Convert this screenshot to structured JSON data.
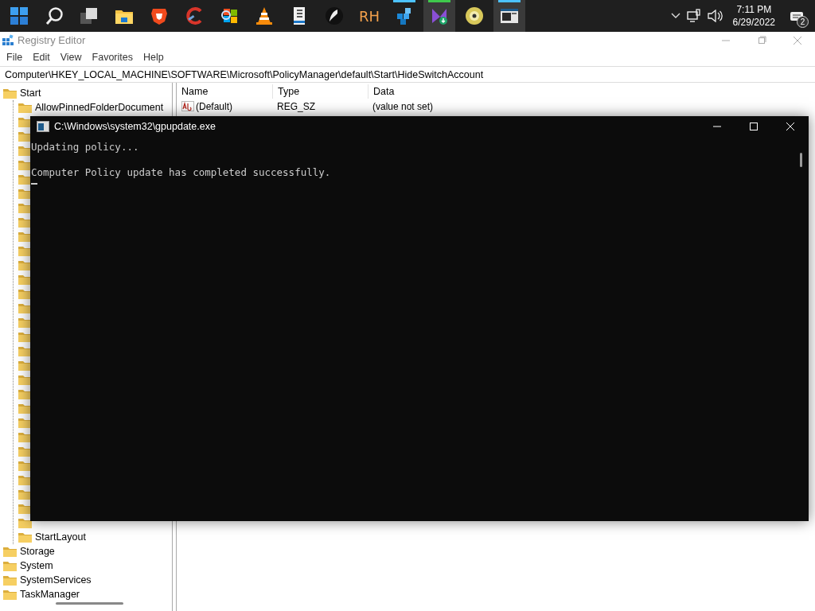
{
  "taskbar": {
    "apps": [
      {
        "kind": "start",
        "indicator": false,
        "selected": false
      },
      {
        "kind": "search",
        "indicator": false,
        "selected": false
      },
      {
        "kind": "taskview",
        "indicator": false,
        "selected": false
      },
      {
        "kind": "explorer",
        "indicator": false,
        "selected": false
      },
      {
        "kind": "lion",
        "indicator": false,
        "selected": false
      },
      {
        "kind": "cleaner",
        "indicator": false,
        "selected": false
      },
      {
        "kind": "flag",
        "indicator": false,
        "selected": false
      },
      {
        "kind": "cone",
        "indicator": false,
        "selected": false
      },
      {
        "kind": "book",
        "indicator": false,
        "selected": false
      },
      {
        "kind": "feather",
        "indicator": false,
        "selected": false
      },
      {
        "kind": "text",
        "label": "RH",
        "indicator": false,
        "selected": false
      },
      {
        "kind": "cubes",
        "indicator": true,
        "selected": false
      },
      {
        "kind": "installer",
        "indicator": true,
        "selected": true
      },
      {
        "kind": "disc",
        "indicator": false,
        "selected": false
      },
      {
        "kind": "console",
        "indicator": true,
        "selected": true
      }
    ],
    "tray": {
      "time": "7:11 PM",
      "date": "6/29/2022",
      "notifications": "2"
    }
  },
  "regedit": {
    "title": "Registry Editor",
    "menu": [
      "File",
      "Edit",
      "View",
      "Favorites",
      "Help"
    ],
    "address": "Computer\\HKEY_LOCAL_MACHINE\\SOFTWARE\\Microsoft\\PolicyManager\\default\\Start\\HideSwitchAccount",
    "tree": [
      {
        "label": "Start",
        "children": [
          {
            "kind": "folder",
            "label": "AllowPinnedFolderDocument"
          },
          {
            "kind": "folder"
          },
          {
            "kind": "folder"
          },
          {
            "kind": "folder"
          },
          {
            "kind": "folder"
          },
          {
            "kind": "folder"
          },
          {
            "kind": "folder"
          },
          {
            "kind": "folder"
          },
          {
            "kind": "folder"
          },
          {
            "kind": "folder"
          },
          {
            "kind": "folder"
          },
          {
            "kind": "folder"
          },
          {
            "kind": "folder"
          },
          {
            "kind": "folder"
          },
          {
            "kind": "folder"
          },
          {
            "kind": "folder"
          },
          {
            "kind": "folder"
          },
          {
            "kind": "folder"
          },
          {
            "kind": "folder"
          },
          {
            "kind": "folder"
          },
          {
            "kind": "folder"
          },
          {
            "kind": "folder"
          },
          {
            "kind": "folder"
          },
          {
            "kind": "folder"
          },
          {
            "kind": "folder"
          },
          {
            "kind": "folder"
          },
          {
            "kind": "folder"
          },
          {
            "kind": "folder"
          },
          {
            "kind": "folder"
          },
          {
            "kind": "folder"
          },
          {
            "kind": "folder",
            "label": "StartLayout"
          }
        ]
      },
      {
        "label": "Storage"
      },
      {
        "label": "System"
      },
      {
        "label": "SystemServices"
      },
      {
        "label": "TaskManager"
      }
    ],
    "columns": [
      "Name",
      "Type",
      "Data"
    ],
    "rows": [
      {
        "name": "(Default)",
        "type": "REG_SZ",
        "data": "(value not set)"
      }
    ]
  },
  "console": {
    "title": "C:\\Windows\\system32\\gpupdate.exe",
    "lines": [
      "Updating policy...",
      "Computer Policy update has completed successfully."
    ]
  }
}
